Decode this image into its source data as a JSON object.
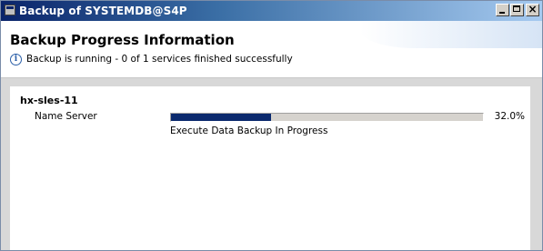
{
  "window": {
    "title": "Backup of SYSTEMDB@S4P"
  },
  "header": {
    "title": "Backup Progress Information",
    "info_text": "Backup is running - 0 of 1 services finished successfully"
  },
  "host": {
    "name": "hx-sles-11",
    "services": [
      {
        "name": "Name Server",
        "progress_percent": 32.0,
        "progress_label": "32.0%",
        "status": "Execute Data Backup In Progress"
      }
    ]
  },
  "colors": {
    "titlebar_start": "#0a246a",
    "progress_fill": "#0b2a6e",
    "progress_track": "#d6d3ce",
    "info_icon": "#2b5fa8"
  },
  "icons": {
    "window_icon": "app-window-icon",
    "info": "info-icon",
    "minimize": "minimize-icon",
    "maximize": "maximize-icon",
    "close": "close-icon"
  }
}
